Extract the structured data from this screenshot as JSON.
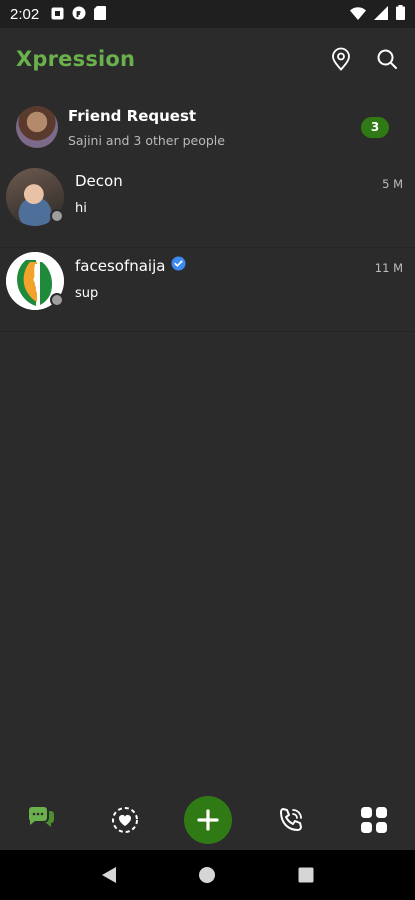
{
  "status_bar": {
    "time": "2:02",
    "notification_icons": [
      "square-notification-icon",
      "f-notification-icon",
      "sd-card-icon"
    ],
    "system_icons": [
      "wifi-icon",
      "cellular-signal-icon",
      "battery-icon"
    ]
  },
  "header": {
    "title": "Xpression",
    "actions": [
      "location-pin-icon",
      "search-icon"
    ]
  },
  "friend_request": {
    "title": "Friend Request",
    "subtitle": "Sajini and 3 other people",
    "count": "3"
  },
  "chats": [
    {
      "name": "Decon",
      "message": "hi",
      "time": "5 M",
      "verified": false
    },
    {
      "name": "facesofnaija",
      "message": "sup",
      "time": "11 M",
      "verified": true
    }
  ],
  "bottom_nav": {
    "items": [
      "chats-icon",
      "status-heart-icon",
      "add-icon",
      "calls-icon",
      "apps-grid-icon"
    ]
  },
  "system_nav": [
    "back-icon",
    "home-icon",
    "recents-icon"
  ],
  "colors": {
    "accent": "#6ab04c",
    "accent_dark": "#2f7a14",
    "background": "#2b2b2b",
    "verified_blue": "#3d8bf2"
  }
}
